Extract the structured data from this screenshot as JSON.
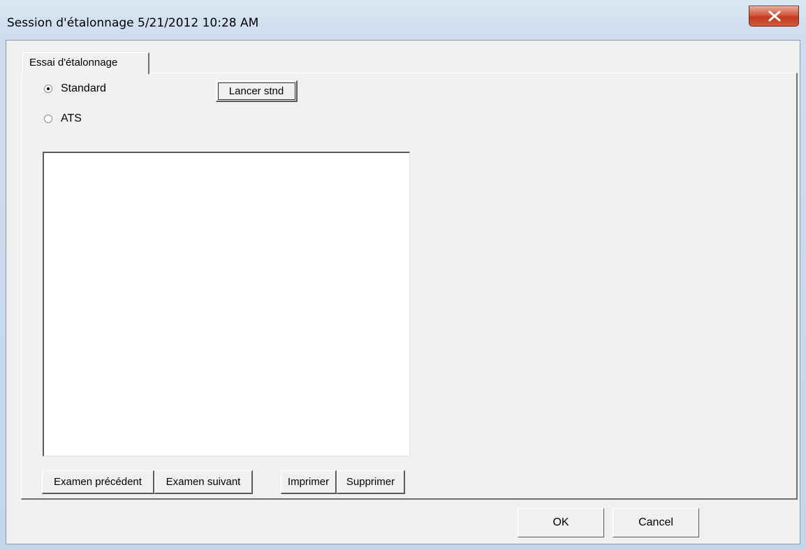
{
  "window": {
    "title": "Session d'étalonnage 5/21/2012 10:28 AM"
  },
  "tabs": [
    {
      "label": "Essai d'étalonnage",
      "active": true
    }
  ],
  "options": {
    "standard_label": "Standard",
    "ats_label": "ATS",
    "selected": "Standard"
  },
  "buttons": {
    "run_standard": "Lancer stnd",
    "previous_exam": "Examen précédent",
    "next_exam": "Examen suivant",
    "print": "Imprimer",
    "delete": "Supprimer",
    "ok": "OK",
    "cancel": "Cancel"
  },
  "colors": {
    "close_button": "#c23a1f",
    "dialog_background": "#f0f0f0"
  },
  "icons": {
    "close": "close-icon"
  }
}
